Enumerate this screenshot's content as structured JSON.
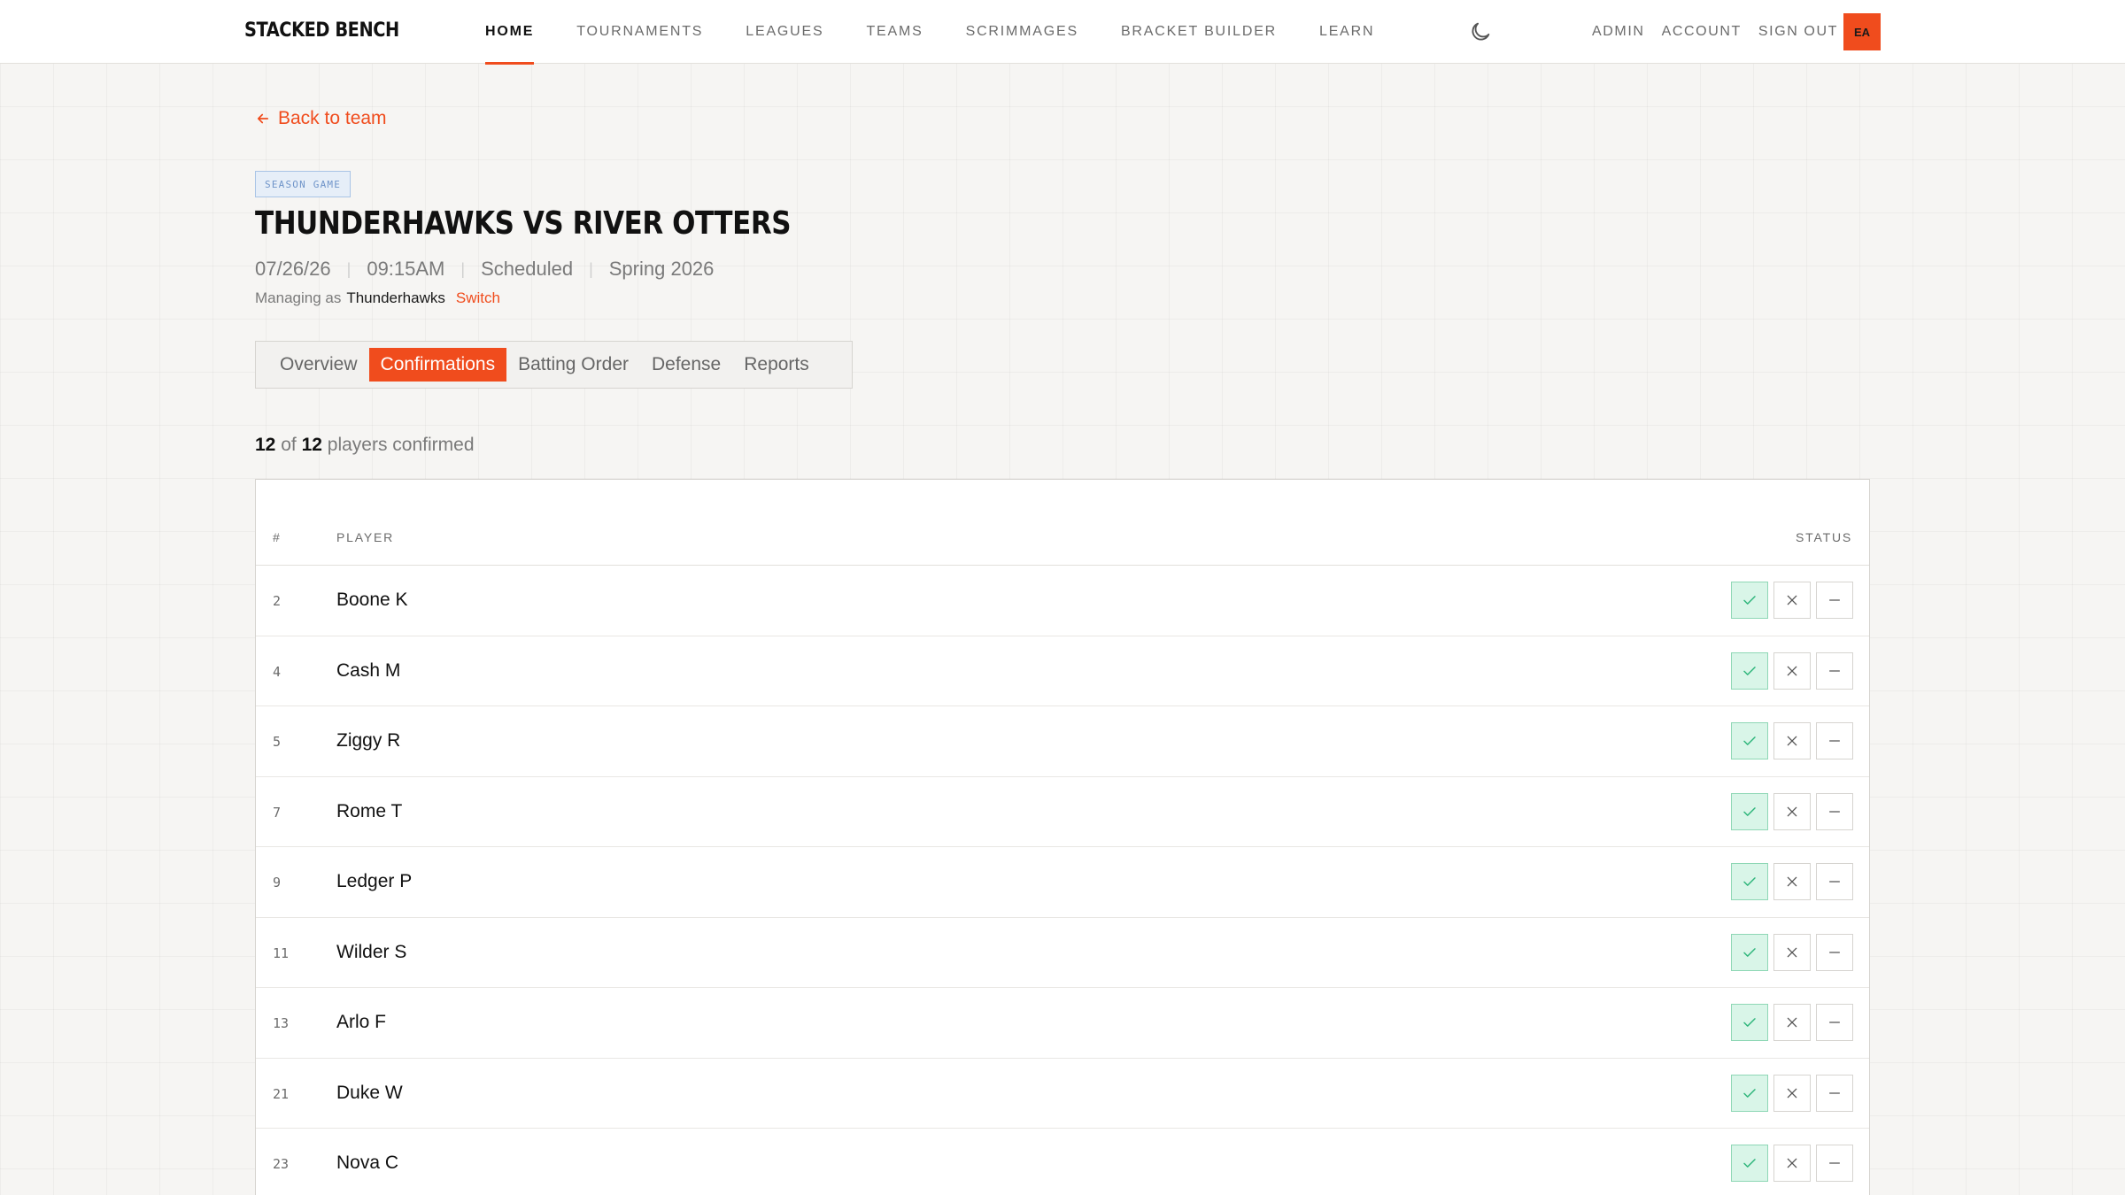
{
  "nav": {
    "logo": "STACKED BENCH",
    "items": [
      {
        "label": "HOME",
        "active": true
      },
      {
        "label": "TOURNAMENTS",
        "active": false
      },
      {
        "label": "LEAGUES",
        "active": false
      },
      {
        "label": "TEAMS",
        "active": false
      },
      {
        "label": "SCRIMMAGES",
        "active": false
      },
      {
        "label": "BRACKET BUILDER",
        "active": false
      },
      {
        "label": "LEARN",
        "active": false
      }
    ],
    "theme_icon": "moon-icon",
    "account_links": [
      "ADMIN",
      "ACCOUNT",
      "SIGN OUT"
    ],
    "avatar_initials": "EA"
  },
  "header": {
    "back_label": "Back to team",
    "badge": "SEASON GAME",
    "title": "THUNDERHAWKS VS RIVER OTTERS",
    "date": "07/26/26",
    "time": "09:15AM",
    "status": "Scheduled",
    "season": "Spring 2026",
    "managing_prefix": "Managing as",
    "managing_team": "Thunderhawks",
    "switch_label": "Switch"
  },
  "tabs": [
    {
      "label": "Overview",
      "active": false
    },
    {
      "label": "Confirmations",
      "active": true
    },
    {
      "label": "Batting Order",
      "active": false
    },
    {
      "label": "Defense",
      "active": false
    },
    {
      "label": "Reports",
      "active": false
    }
  ],
  "summary": {
    "confirmed": "12",
    "of_label": "of",
    "total": "12",
    "suffix": "players confirmed"
  },
  "table": {
    "columns": {
      "num": "#",
      "player": "PLAYER",
      "status": "STATUS"
    },
    "rows": [
      {
        "num": "2",
        "player": "Boone K",
        "status": "confirmed"
      },
      {
        "num": "4",
        "player": "Cash M",
        "status": "confirmed"
      },
      {
        "num": "5",
        "player": "Ziggy R",
        "status": "confirmed"
      },
      {
        "num": "7",
        "player": "Rome T",
        "status": "confirmed"
      },
      {
        "num": "9",
        "player": "Ledger P",
        "status": "confirmed"
      },
      {
        "num": "11",
        "player": "Wilder S",
        "status": "confirmed"
      },
      {
        "num": "13",
        "player": "Arlo F",
        "status": "confirmed"
      },
      {
        "num": "21",
        "player": "Duke W",
        "status": "confirmed"
      },
      {
        "num": "23",
        "player": "Nova C",
        "status": "confirmed"
      }
    ]
  },
  "colors": {
    "accent": "#f04c1d",
    "confirmed_bg": "#d9f5e8",
    "confirmed_border": "#8ed7b5",
    "check": "#2fb67c",
    "badge_blue": "#6f94c9"
  }
}
